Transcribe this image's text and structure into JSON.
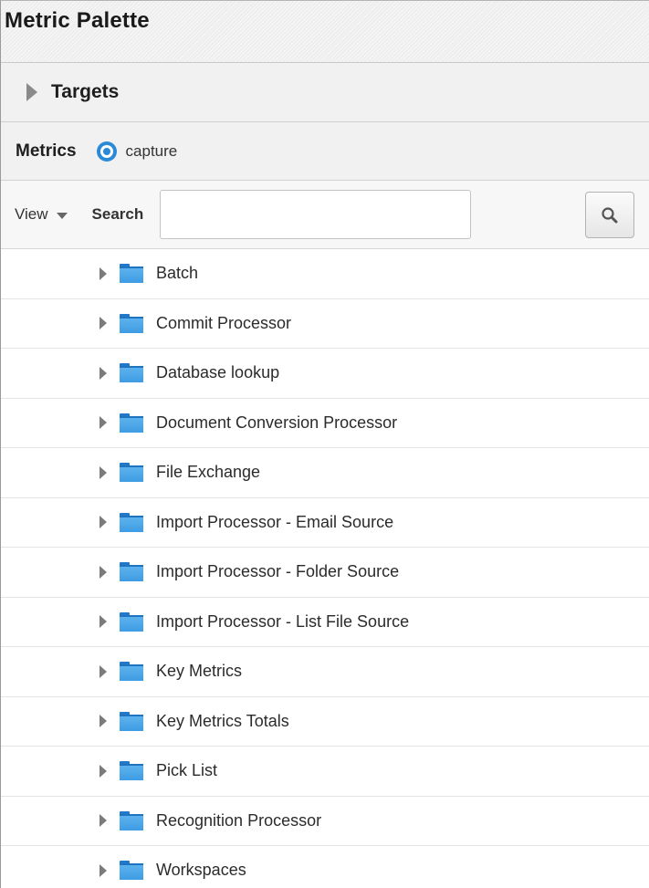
{
  "palette": {
    "title": "Metric Palette",
    "targets_label": "Targets",
    "metrics_label": "Metrics",
    "capture_label": "capture"
  },
  "toolbar": {
    "view_label": "View",
    "search_label": "Search",
    "search_value": "",
    "search_placeholder": ""
  },
  "tree": {
    "items": [
      {
        "label": "Batch"
      },
      {
        "label": "Commit Processor"
      },
      {
        "label": "Database lookup"
      },
      {
        "label": "Document Conversion Processor"
      },
      {
        "label": "File Exchange"
      },
      {
        "label": "Import Processor - Email Source"
      },
      {
        "label": "Import Processor - Folder Source"
      },
      {
        "label": "Import Processor - List File Source"
      },
      {
        "label": "Key Metrics"
      },
      {
        "label": "Key Metrics Totals"
      },
      {
        "label": "Pick List"
      },
      {
        "label": "Recognition Processor"
      },
      {
        "label": "Workspaces"
      }
    ]
  },
  "colors": {
    "accent": "#2a8ad7",
    "folder": "#3e9ce3",
    "header_bg": "#f1f1f1"
  },
  "icons": [
    "disclosure-triangle-icon",
    "target-icon",
    "chevron-down-icon",
    "magnifier-icon",
    "expand-arrow-icon",
    "folder-icon"
  ]
}
